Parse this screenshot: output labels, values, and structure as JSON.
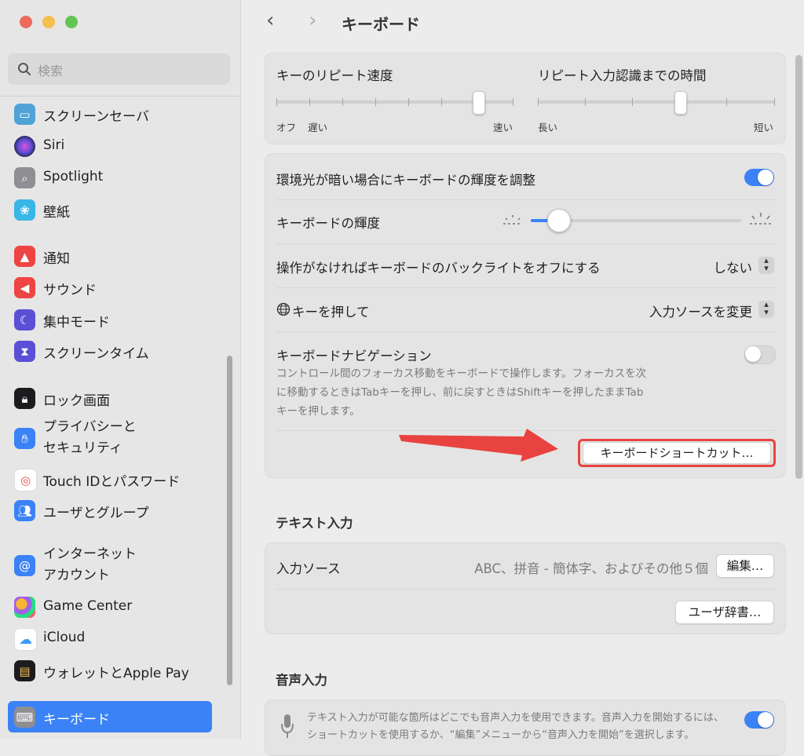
{
  "window": {
    "title": "キーボード"
  },
  "search": {
    "placeholder": "検索"
  },
  "sidebar": {
    "items": [
      {
        "label": "スクリーンセーバ",
        "icon": "screensaver-icon",
        "color": "#4fa3d6"
      },
      {
        "label": "Siri",
        "icon": "siri-icon",
        "color": "#1c1c2e"
      },
      {
        "label": "Spotlight",
        "icon": "spotlight-icon",
        "color": "#8e8e93"
      },
      {
        "label": "壁紙",
        "icon": "wallpaper-icon",
        "color": "#38b6e6"
      },
      {
        "label": "通知",
        "icon": "notifications-icon",
        "color": "#ef4444"
      },
      {
        "label": "サウンド",
        "icon": "sound-icon",
        "color": "#ef4444"
      },
      {
        "label": "集中モード",
        "icon": "focus-icon",
        "color": "#5b4fd6"
      },
      {
        "label": "スクリーンタイム",
        "icon": "screen-time-icon",
        "color": "#5b4fd6"
      },
      {
        "label": "ロック画面",
        "icon": "lock-icon",
        "color": "#1c1c1e"
      },
      {
        "label_line1": "プライバシーと",
        "label_line2": "セキュリティ",
        "icon": "privacy-hand-icon",
        "color": "#3b82f6"
      },
      {
        "label": "Touch IDとパスワード",
        "icon": "fingerprint-icon",
        "color": "#ffffff"
      },
      {
        "label": "ユーザとグループ",
        "icon": "users-icon",
        "color": "#3b82f6"
      },
      {
        "label_line1": "インターネット",
        "label_line2": "アカウント",
        "icon": "at-icon",
        "color": "#3b82f6"
      },
      {
        "label": "Game Center",
        "icon": "game-center-icon",
        "color": "#ffffff"
      },
      {
        "label": "iCloud",
        "icon": "icloud-icon",
        "color": "#ffffff"
      },
      {
        "label": "ウォレットとApple Pay",
        "icon": "wallet-icon",
        "color": "#1c1c1e"
      },
      {
        "label": "キーボード",
        "icon": "keyboard-icon",
        "color": "#8e8e93",
        "selected": true
      }
    ]
  },
  "repeat": {
    "speed_label": "キーのリピート速度",
    "speed_left": "オフ",
    "speed_left2": "遅い",
    "speed_right": "速い",
    "speed_level": 0.85,
    "delay_label": "リピート入力認識までの時間",
    "delay_left": "長い",
    "delay_right": "短い",
    "delay_level": 0.6
  },
  "backlight": {
    "auto_label": "環境光が暗い場合にキーボードの輝度を調整",
    "auto_on": true,
    "brightness_label": "キーボードの輝度",
    "brightness_level": 0.08,
    "off_label": "操作がなければキーボードのバックライトをオフにする",
    "off_value": "しない",
    "globe_label": "キーを押して",
    "globe_value": "入力ソースを変更"
  },
  "navigation": {
    "label": "キーボードナビゲーション",
    "on": false,
    "desc_line1": "コントロール間のフォーカス移動をキーボードで操作します。フォーカスを次",
    "desc_line2": "に移動するときはTabキーを押し、前に戻すときはShiftキーを押したままTab",
    "desc_line3": "キーを押します。",
    "shortcuts_button": "キーボードショートカット…"
  },
  "text_input": {
    "section": "テキスト入力",
    "source_label": "入力ソース",
    "source_value": "ABC、拼音 - 簡体字、およびその他５個",
    "edit_button": "編集…",
    "dictionary_button": "ユーザ辞書…"
  },
  "dictation": {
    "section": "音声入力",
    "on": true,
    "desc_line1": "テキスト入力が可能な箇所はどこでも音声入力を使用できます。音声入力を開始するには、",
    "desc_line2": "ショートカットを使用するか、“編集”メニューから“音声入力を開始”を選択します。"
  },
  "colors": {
    "accent": "#3b82f6",
    "annotation": "#e8433f"
  }
}
